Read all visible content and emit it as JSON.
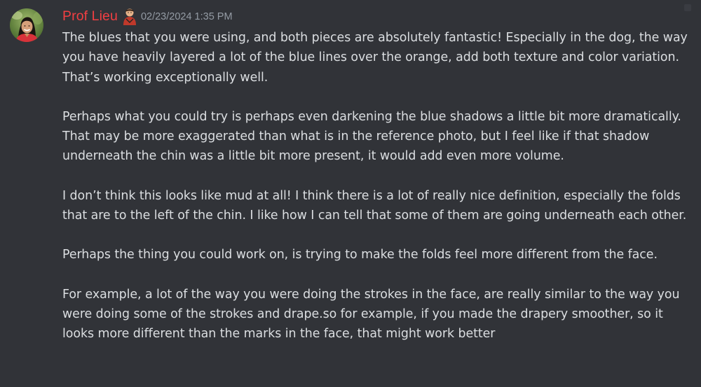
{
  "message": {
    "author": {
      "name": "Prof Lieu",
      "name_color": "#f23f42",
      "avatar_icon": "user-avatar-photo",
      "role_icon": "person-emoji-icon"
    },
    "timestamp": "02/23/2024 1:35 PM",
    "paragraphs": [
      "The blues that you were using, and both pieces are absolutely fantastic! Especially in the dog, the way you have heavily layered a lot of the blue lines over the orange, add both texture and color variation. That’s working exceptionally well.",
      "Perhaps what you could try is perhaps even darkening the blue shadows a little bit more dramatically. That may be more exaggerated than what is in the reference photo, but I feel like if that shadow underneath the chin was a little bit more present, it would add even more volume.",
      "I don’t think this looks like mud at all! I think there is a lot of really nice definition, especially the folds that are to the left of the chin. I like how I can tell that some of them are going underneath each other.",
      "Perhaps the thing you could work on, is trying to make the folds feel more different from the face.",
      "For example, a lot of the way you were doing the strokes in the face, are really similar to the way you were doing some of the strokes and drape.so for example, if you made the drapery smoother, so it looks more different than the marks in the face, that might work better"
    ]
  },
  "theme": {
    "background": "#313338",
    "text": "#dbdee1",
    "muted": "#949ba4"
  }
}
